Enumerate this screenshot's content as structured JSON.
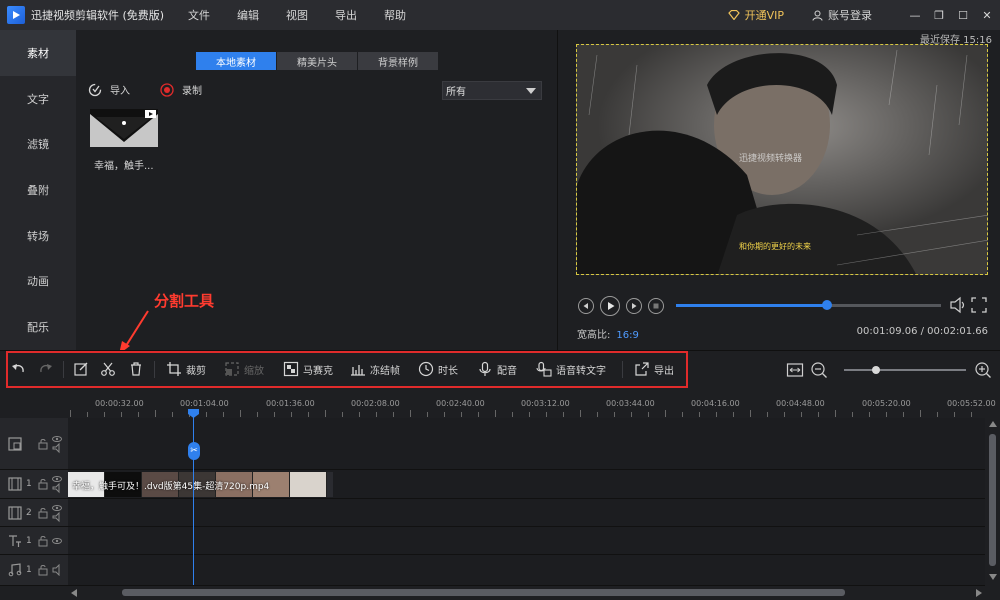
{
  "window": {
    "title": "迅捷视频剪辑软件 (免费版)",
    "menu": [
      "文件",
      "编辑",
      "视图",
      "导出",
      "帮助"
    ],
    "vip_label": "开通VIP",
    "login_label": "账号登录",
    "controls": [
      "—",
      "❐",
      "☐",
      "✕"
    ]
  },
  "sidebar": {
    "items": [
      "素材",
      "文字",
      "滤镜",
      "叠附",
      "转场",
      "动画",
      "配乐"
    ],
    "active_index": 0
  },
  "media": {
    "tabs": [
      "本地素材",
      "精美片头",
      "背景样例"
    ],
    "active_tab": 0,
    "import_label": "导入",
    "record_label": "录制",
    "filter_value": "所有",
    "items": [
      {
        "caption": "幸福，触手..."
      }
    ]
  },
  "preview": {
    "saved_text": "最近保存 15:16",
    "watermark_text": "迅捷视频转换器",
    "subtitle_text": "和你期的更好的未来",
    "aspect_label": "宽高比:",
    "aspect_value": "16:9",
    "timecode": "00:01:09.06 / 00:02:01.66",
    "progress": 0.57
  },
  "annotation": {
    "text": "分割工具"
  },
  "toolbar": {
    "crop": "裁剪",
    "zoom": "缩放",
    "mosaic": "马赛克",
    "freeze": "冻结帧",
    "duration": "时长",
    "dub": "配音",
    "speech_to_text": "语音转文字",
    "export": "导出",
    "zoom_level": 0.26
  },
  "timeline": {
    "ruler": [
      "00:00:32.00",
      "00:01:04.00",
      "00:01:36.00",
      "00:02:08.00",
      "00:02:40.00",
      "00:03:12.00",
      "00:03:44.00",
      "00:04:16.00",
      "00:04:48.00",
      "00:05:20.00",
      "00:05:52.00"
    ],
    "tracks": [
      {
        "type": "pip",
        "num": ""
      },
      {
        "type": "video",
        "num": "1"
      },
      {
        "type": "video",
        "num": "2"
      },
      {
        "type": "text",
        "num": "1"
      },
      {
        "type": "music",
        "num": "1"
      }
    ],
    "clip_label": "幸福，触手可及！.dvd版第45集-超清720p.mp4",
    "split_glyph": "✂"
  }
}
